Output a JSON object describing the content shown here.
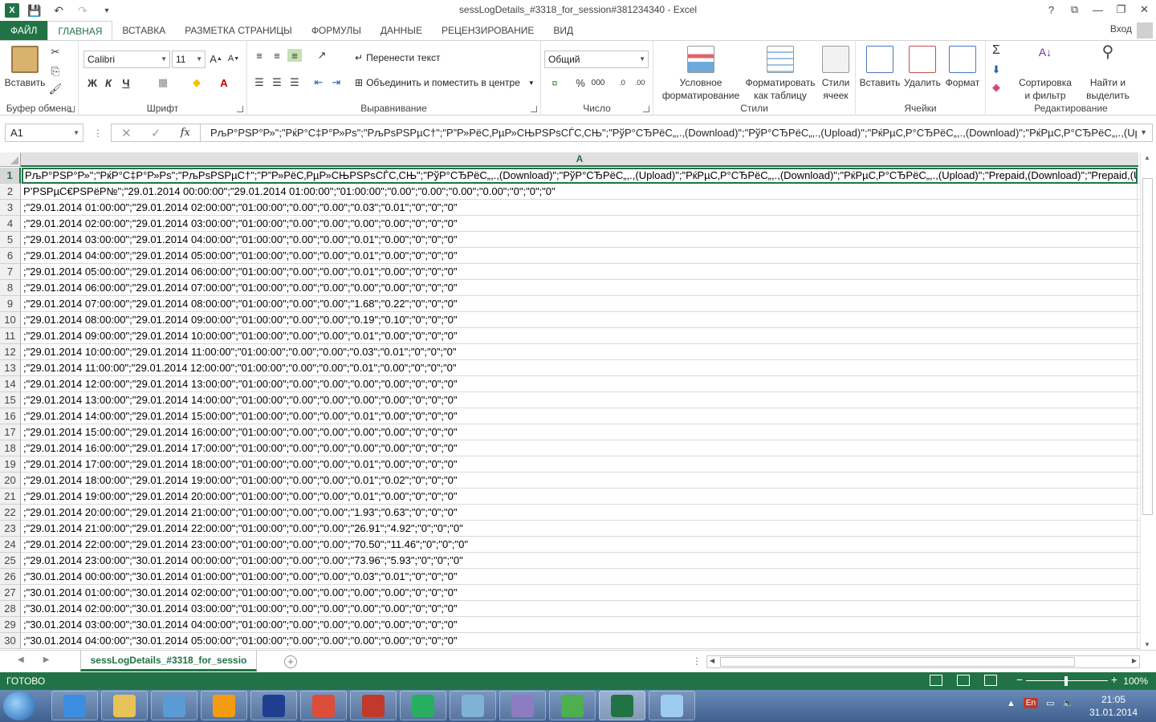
{
  "window": {
    "title": "sessLogDetails_#3318_for_session#381234340 - Excel"
  },
  "qat": {
    "logo": "X"
  },
  "window_controls": [
    "?",
    "⧉",
    "—",
    "❐",
    "✕"
  ],
  "tabs": [
    "ФАЙЛ",
    "ГЛАВНАЯ",
    "ВСТАВКА",
    "РАЗМЕТКА СТРАНИЦЫ",
    "ФОРМУЛЫ",
    "ДАННЫЕ",
    "РЕЦЕНЗИРОВАНИЕ",
    "ВИД"
  ],
  "account": {
    "login": "Вход"
  },
  "ribbon": {
    "clipboard": {
      "label": "Буфер обмена",
      "paste": "Вставить"
    },
    "font": {
      "label": "Шрифт",
      "name": "Calibri",
      "size": "11",
      "bold": "Ж",
      "italic": "К",
      "underline": "Ч"
    },
    "alignment": {
      "label": "Выравнивание",
      "wrap": "Перенести текст",
      "merge": "Объединить и поместить в центре"
    },
    "number": {
      "label": "Число",
      "format": "Общий"
    },
    "styles": {
      "label": "Стили",
      "conditional_1": "Условное",
      "conditional_2": "форматирование",
      "table_1": "Форматировать",
      "table_2": "как таблицу",
      "cell_1": "Стили",
      "cell_2": "ячеек"
    },
    "cells": {
      "label": "Ячейки",
      "insert": "Вставить",
      "delete": "Удалить",
      "format": "Формат"
    },
    "editing": {
      "label": "Редактирование",
      "sort_1": "Сортировка",
      "sort_2": "и фильтр",
      "find_1": "Найти и",
      "find_2": "выделить"
    }
  },
  "formula_bar": {
    "name_box": "A1",
    "content": "РљР°РЅР°Р»\";\"РќР°С‡Р°Р»Рѕ\";\"РљРѕРЅРµС†\";\"Р”Р»РёС‚РµР»СЊРЅРѕСЃС‚СЊ\";\"РўР°СЂРёС„,.,(Download)\";\"РўР°СЂРёС„,.,(Upload)\";\"РќРµС‚Р°СЂРёС„,.,(Download)\";\"РќРµС‚Р°СЂРёС„,.,(Upl"
  },
  "sheet": {
    "column": "A",
    "rows": [
      "РљР°РЅР°Р»\";\"РќР°С‡Р°Р»Рѕ\";\"РљРѕРЅРµС†\";\"Р”Р»РёС‚РµР»СЊРЅРѕСЃС‚СЊ\";\"РўР°СЂРёС„,.,(Download)\";\"РўР°СЂРёС„,.,(Upload)\";\"РќРµС‚Р°СЂРёС„,.,(Download)\";\"РќРµС‚Р°СЂРёС„,.,(Upload)\";\"Prepaid,(Download)\";\"Prepaid,(U",
      "Р’РЅРµС€РЅРёР№\";\"29.01.2014 00:00:00\";\"29.01.2014 01:00:00\";\"01:00:00\";\"0.00\";\"0.00\";\"0.00\";\"0.00\";\"0\";\"0\";\"0\"",
      ";\"29.01.2014 01:00:00\";\"29.01.2014 02:00:00\";\"01:00:00\";\"0.00\";\"0.00\";\"0.03\";\"0.01\";\"0\";\"0\";\"0\"",
      ";\"29.01.2014 02:00:00\";\"29.01.2014 03:00:00\";\"01:00:00\";\"0.00\";\"0.00\";\"0.00\";\"0.00\";\"0\";\"0\";\"0\"",
      ";\"29.01.2014 03:00:00\";\"29.01.2014 04:00:00\";\"01:00:00\";\"0.00\";\"0.00\";\"0.01\";\"0.00\";\"0\";\"0\";\"0\"",
      ";\"29.01.2014 04:00:00\";\"29.01.2014 05:00:00\";\"01:00:00\";\"0.00\";\"0.00\";\"0.01\";\"0.00\";\"0\";\"0\";\"0\"",
      ";\"29.01.2014 05:00:00\";\"29.01.2014 06:00:00\";\"01:00:00\";\"0.00\";\"0.00\";\"0.01\";\"0.00\";\"0\";\"0\";\"0\"",
      ";\"29.01.2014 06:00:00\";\"29.01.2014 07:00:00\";\"01:00:00\";\"0.00\";\"0.00\";\"0.00\";\"0.00\";\"0\";\"0\";\"0\"",
      ";\"29.01.2014 07:00:00\";\"29.01.2014 08:00:00\";\"01:00:00\";\"0.00\";\"0.00\";\"1.68\";\"0.22\";\"0\";\"0\";\"0\"",
      ";\"29.01.2014 08:00:00\";\"29.01.2014 09:00:00\";\"01:00:00\";\"0.00\";\"0.00\";\"0.19\";\"0.10\";\"0\";\"0\";\"0\"",
      ";\"29.01.2014 09:00:00\";\"29.01.2014 10:00:00\";\"01:00:00\";\"0.00\";\"0.00\";\"0.01\";\"0.00\";\"0\";\"0\";\"0\"",
      ";\"29.01.2014 10:00:00\";\"29.01.2014 11:00:00\";\"01:00:00\";\"0.00\";\"0.00\";\"0.03\";\"0.01\";\"0\";\"0\";\"0\"",
      ";\"29.01.2014 11:00:00\";\"29.01.2014 12:00:00\";\"01:00:00\";\"0.00\";\"0.00\";\"0.01\";\"0.00\";\"0\";\"0\";\"0\"",
      ";\"29.01.2014 12:00:00\";\"29.01.2014 13:00:00\";\"01:00:00\";\"0.00\";\"0.00\";\"0.00\";\"0.00\";\"0\";\"0\";\"0\"",
      ";\"29.01.2014 13:00:00\";\"29.01.2014 14:00:00\";\"01:00:00\";\"0.00\";\"0.00\";\"0.00\";\"0.00\";\"0\";\"0\";\"0\"",
      ";\"29.01.2014 14:00:00\";\"29.01.2014 15:00:00\";\"01:00:00\";\"0.00\";\"0.00\";\"0.01\";\"0.00\";\"0\";\"0\";\"0\"",
      ";\"29.01.2014 15:00:00\";\"29.01.2014 16:00:00\";\"01:00:00\";\"0.00\";\"0.00\";\"0.00\";\"0.00\";\"0\";\"0\";\"0\"",
      ";\"29.01.2014 16:00:00\";\"29.01.2014 17:00:00\";\"01:00:00\";\"0.00\";\"0.00\";\"0.00\";\"0.00\";\"0\";\"0\";\"0\"",
      ";\"29.01.2014 17:00:00\";\"29.01.2014 18:00:00\";\"01:00:00\";\"0.00\";\"0.00\";\"0.01\";\"0.00\";\"0\";\"0\";\"0\"",
      ";\"29.01.2014 18:00:00\";\"29.01.2014 19:00:00\";\"01:00:00\";\"0.00\";\"0.00\";\"0.01\";\"0.02\";\"0\";\"0\";\"0\"",
      ";\"29.01.2014 19:00:00\";\"29.01.2014 20:00:00\";\"01:00:00\";\"0.00\";\"0.00\";\"0.01\";\"0.00\";\"0\";\"0\";\"0\"",
      ";\"29.01.2014 20:00:00\";\"29.01.2014 21:00:00\";\"01:00:00\";\"0.00\";\"0.00\";\"1.93\";\"0.63\";\"0\";\"0\";\"0\"",
      ";\"29.01.2014 21:00:00\";\"29.01.2014 22:00:00\";\"01:00:00\";\"0.00\";\"0.00\";\"26.91\";\"4.92\";\"0\";\"0\";\"0\"",
      ";\"29.01.2014 22:00:00\";\"29.01.2014 23:00:00\";\"01:00:00\";\"0.00\";\"0.00\";\"70.50\";\"11.46\";\"0\";\"0\";\"0\"",
      ";\"29.01.2014 23:00:00\";\"30.01.2014 00:00:00\";\"01:00:00\";\"0.00\";\"0.00\";\"73.96\";\"5.93\";\"0\";\"0\";\"0\"",
      ";\"30.01.2014 00:00:00\";\"30.01.2014 01:00:00\";\"01:00:00\";\"0.00\";\"0.00\";\"0.03\";\"0.01\";\"0\";\"0\";\"0\"",
      ";\"30.01.2014 01:00:00\";\"30.01.2014 02:00:00\";\"01:00:00\";\"0.00\";\"0.00\";\"0.00\";\"0.00\";\"0\";\"0\";\"0\"",
      ";\"30.01.2014 02:00:00\";\"30.01.2014 03:00:00\";\"01:00:00\";\"0.00\";\"0.00\";\"0.00\";\"0.00\";\"0\";\"0\";\"0\"",
      ";\"30.01.2014 03:00:00\";\"30.01.2014 04:00:00\";\"01:00:00\";\"0.00\";\"0.00\";\"0.00\";\"0.00\";\"0\";\"0\";\"0\"",
      ";\"30.01.2014 04:00:00\";\"30.01.2014 05:00:00\";\"01:00:00\";\"0.00\";\"0.00\";\"0.00\";\"0.00\";\"0\";\"0\";\"0\""
    ]
  },
  "sheet_tab": {
    "name": "sessLogDetails_#3318_for_sessio"
  },
  "status": {
    "ready": "ГОТОВО",
    "zoom": "100%"
  },
  "taskbar": {
    "apps": [
      "internet-explorer",
      "file-explorer",
      "media-player",
      "app-orange",
      "save-disk",
      "chrome",
      "opera",
      "mail-agent",
      "notepad",
      "tor-browser",
      "globe",
      "excel",
      "paint"
    ],
    "lang": "En",
    "time": "21:05",
    "date": "31.01.2014"
  },
  "colors": {
    "accent": "#217346"
  }
}
